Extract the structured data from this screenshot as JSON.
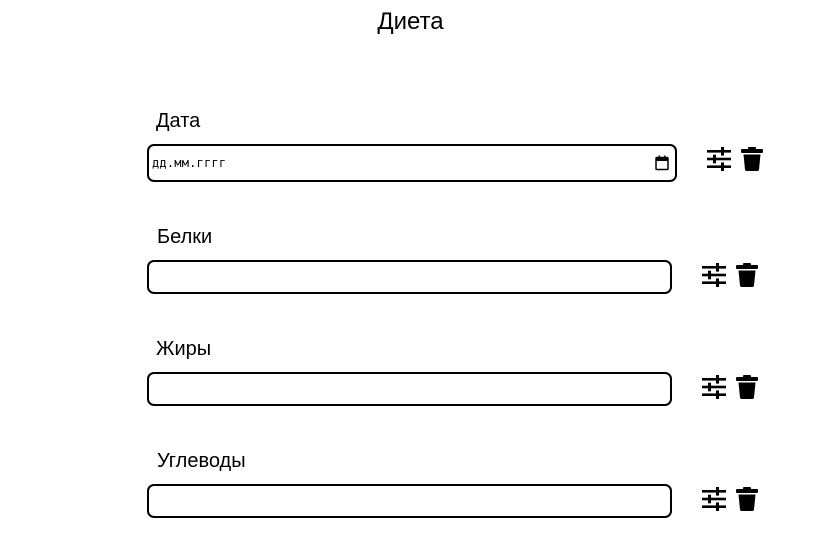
{
  "page": {
    "title": "Диета"
  },
  "fields": [
    {
      "label": "Дата",
      "type": "date",
      "placeholder": "дд.мм.гггг",
      "value": "",
      "icons": [
        "calendar-icon",
        "sliders-icon",
        "trash-icon"
      ]
    },
    {
      "label": "Белки",
      "type": "text",
      "value": "",
      "icons": [
        "sliders-icon",
        "trash-icon"
      ]
    },
    {
      "label": "Жиры",
      "type": "text",
      "value": "",
      "icons": [
        "sliders-icon",
        "trash-icon"
      ]
    },
    {
      "label": "Углеводы",
      "type": "text",
      "value": "",
      "icons": [
        "sliders-icon",
        "trash-icon"
      ]
    }
  ]
}
